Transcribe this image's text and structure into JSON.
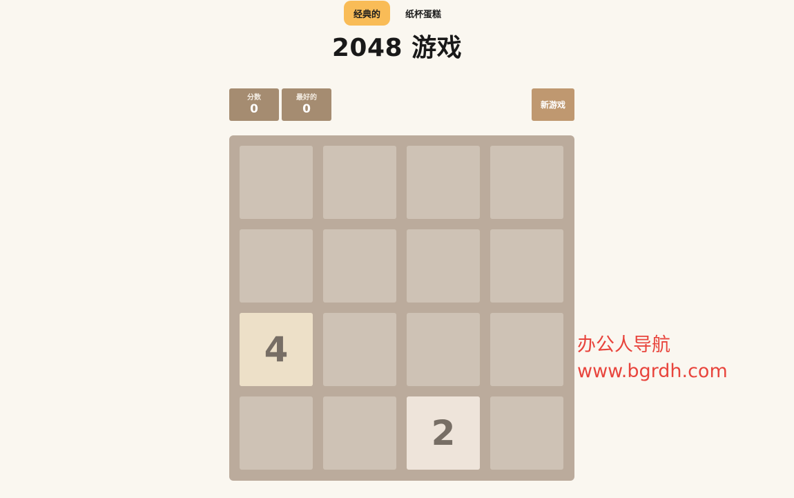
{
  "tabs": [
    {
      "label": "经典的",
      "active": true
    },
    {
      "label": "纸杯蛋糕",
      "active": false
    }
  ],
  "title": "2048 游戏",
  "scores": {
    "score_label": "分数",
    "score_value": "0",
    "best_label": "最好的",
    "best_value": "0"
  },
  "new_game_label": "新游戏",
  "board": {
    "size": 4,
    "grid": [
      [
        0,
        0,
        0,
        0
      ],
      [
        0,
        0,
        0,
        0
      ],
      [
        4,
        0,
        0,
        0
      ],
      [
        0,
        0,
        2,
        0
      ]
    ],
    "colors": {
      "background": "#bbab9c",
      "empty_cell": "#cec2b5",
      "tile_2": "#eee4da",
      "tile_4": "#ede0c8",
      "tile_text": "#776e65"
    }
  },
  "watermark": {
    "line1": "办公人导航",
    "line2": "www.bgrdh.com"
  }
}
